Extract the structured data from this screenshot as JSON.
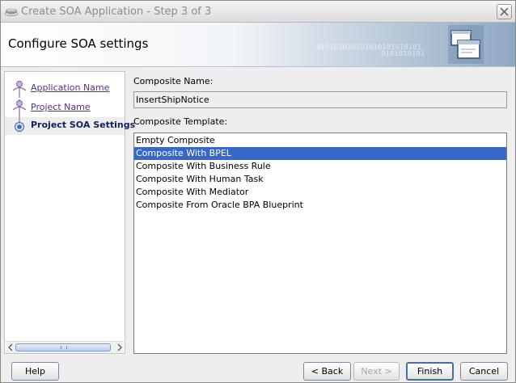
{
  "window": {
    "title": "Create SOA Application - Step 3 of 3",
    "close_icon": "close-icon"
  },
  "banner": {
    "title": "Configure SOA settings",
    "binary_text": "010101010101010101010101",
    "binary_text_2": "0101010101"
  },
  "nav": {
    "items": [
      {
        "label": "Application Name",
        "state": "completed"
      },
      {
        "label": "Project Name",
        "state": "completed"
      },
      {
        "label": "Project SOA Settings",
        "state": "current"
      }
    ]
  },
  "form": {
    "composite_name_label": "Composite Name:",
    "composite_name_value": "InsertShipNotice",
    "composite_template_label": "Composite Template:",
    "templates": [
      {
        "label": "Empty Composite",
        "selected": false
      },
      {
        "label": "Composite With BPEL",
        "selected": true
      },
      {
        "label": "Composite With Business Rule",
        "selected": false
      },
      {
        "label": "Composite With Human Task",
        "selected": false
      },
      {
        "label": "Composite With Mediator",
        "selected": false
      },
      {
        "label": "Composite From Oracle BPA Blueprint",
        "selected": false
      }
    ]
  },
  "buttons": {
    "help": "Help",
    "back": "< Back",
    "next": "Next >",
    "finish": "Finish",
    "cancel": "Cancel"
  },
  "colors": {
    "selection": "#3867c8",
    "link": "#5b2b8a",
    "current_step": "#10225a"
  }
}
